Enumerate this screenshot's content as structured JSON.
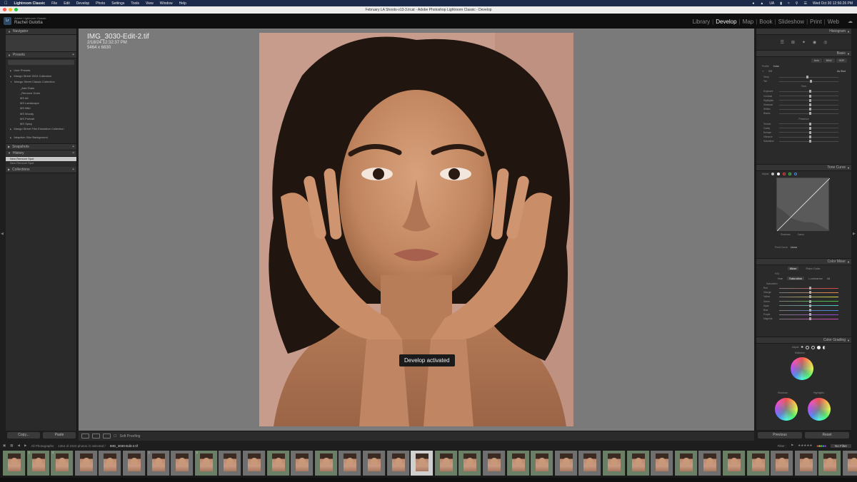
{
  "menubar": {
    "app": "Lightroom Classic",
    "items": [
      "File",
      "Edit",
      "Develop",
      "Photo",
      "Settings",
      "Tools",
      "View",
      "Window",
      "Help"
    ],
    "flag": "UA",
    "datetime": "Wed Oct 30  12:56:26 PM"
  },
  "window": {
    "title": "February LA Shoots-v13-3.lrcat - Adobe Photoshop Lightroom Classic - Develop"
  },
  "identity": {
    "product": "Adobe Lightroom Classic",
    "user": "Rachel Gulotta"
  },
  "modules": {
    "items": [
      "Library",
      "Develop",
      "Map",
      "Book",
      "Slideshow",
      "Print",
      "Web"
    ],
    "active": "Develop"
  },
  "left_panel": {
    "navigator": "Navigator",
    "presets": "Presets",
    "search_placeholder": "",
    "preset_items": [
      {
        "label": "User Presets",
        "level": 1
      },
      {
        "label": "Mango Street 2024 Collection",
        "level": 1
      },
      {
        "label": "Mango Street Classic Collection",
        "level": 1
      },
      {
        "label": "_Add Grain",
        "level": 2
      },
      {
        "label": "_Remove Grain",
        "level": 2
      },
      {
        "label": "MS Alt",
        "level": 2
      },
      {
        "label": "MS Landscape",
        "level": 2
      },
      {
        "label": "MS Mild",
        "level": 2
      },
      {
        "label": "MS Moody",
        "level": 2
      },
      {
        "label": "MS Portrait",
        "level": 2
      },
      {
        "label": "MS Spicy",
        "level": 2
      },
      {
        "label": "Mango Street Film Emulation Collection",
        "level": 1
      },
      {
        "label": "Adaptive: Blur Background",
        "level": 1
      }
    ],
    "snapshots": "Snapshots",
    "history": "History",
    "history_items": [
      "New Remove Spot",
      "New Remove Spot"
    ],
    "collections": "Collections",
    "copy_button": "Copy...",
    "paste_button": "Paste"
  },
  "photo_info": {
    "filename": "IMG_3030-Edit-2.tif",
    "datetime": "2/18/24 12:32:37 PM",
    "dimensions": "5464 x 6830"
  },
  "toast": "Develop activated",
  "toolbar": {
    "soft_proofing": "Soft Proofing"
  },
  "right_panel": {
    "histogram": "Histogram",
    "basic": "Basic",
    "auto_buttons": [
      "Auto",
      "B&W",
      "HDR"
    ],
    "profile_label": "Profile",
    "profile_value": "Color",
    "wb_label": "WB",
    "wb_value": "As Shot",
    "basic_sliders": [
      "Temp",
      "Tint",
      "Exposure",
      "Contrast",
      "Highlights",
      "Shadows",
      "Whites",
      "Blacks",
      "Texture",
      "Clarity",
      "Dehaze",
      "Vibrance",
      "Saturation"
    ],
    "tone_label": "Tone",
    "presence_label": "Presence",
    "tone_curve": "Tone Curve",
    "adjust_label": "Adjust",
    "curve_labels": [
      "Shadows",
      "Darks",
      "Lights",
      "Highlights"
    ],
    "point_curve_label": "Point Curve",
    "point_curve_value": "Linear",
    "color_mixer": "Color Mixer",
    "mixer_tabs": [
      "Mixer",
      "Point Color"
    ],
    "mixer_adjust": "HSL",
    "hsl_tabs": [
      "Hue",
      "Saturation",
      "Luminance",
      "All"
    ],
    "hsl_active": "Saturation",
    "saturation_label": "Saturation",
    "hsl_colors": [
      "Red",
      "Orange",
      "Yellow",
      "Green",
      "Aqua",
      "Blue",
      "Purple",
      "Magenta"
    ],
    "color_grading": "Color Grading",
    "grading_adjust": "Adjust",
    "midtones_label": "Midtones",
    "shadows_label": "Shadows",
    "highlights_label": "Highlights",
    "previous_button": "Previous",
    "reset_button": "Reset"
  },
  "filmbar": {
    "source": "All Photographs",
    "count": "1364 of 2322 photos /1 selected /",
    "selected_file": "IMG_3030-Edit-2.tif",
    "filter_label": "Filter :",
    "filter_value": "No Filter"
  },
  "filmstrip": {
    "cells": [
      {
        "tone": "green"
      },
      {
        "tone": "green",
        "badge": "2"
      },
      {
        "tone": "green",
        "badge": "2"
      },
      {
        "tone": "gray"
      },
      {
        "tone": "gray"
      },
      {
        "tone": "gray"
      },
      {
        "tone": "gray",
        "badge": "2"
      },
      {
        "tone": "gray"
      },
      {
        "tone": "green",
        "badge": "2"
      },
      {
        "tone": "gray"
      },
      {
        "tone": "gray"
      },
      {
        "tone": "green"
      },
      {
        "tone": "gray"
      },
      {
        "tone": "green"
      },
      {
        "tone": "gray"
      },
      {
        "tone": "gray"
      },
      {
        "tone": "gray"
      },
      {
        "tone": "sel",
        "badge": "2"
      },
      {
        "tone": "green"
      },
      {
        "tone": "green"
      },
      {
        "tone": "gray"
      },
      {
        "tone": "green"
      },
      {
        "tone": "green"
      },
      {
        "tone": "gray"
      },
      {
        "tone": "gray"
      },
      {
        "tone": "green"
      },
      {
        "tone": "green"
      },
      {
        "tone": "gray"
      },
      {
        "tone": "green"
      },
      {
        "tone": "gray"
      },
      {
        "tone": "green"
      },
      {
        "tone": "green"
      },
      {
        "tone": "gray"
      },
      {
        "tone": "gray"
      },
      {
        "tone": "green"
      },
      {
        "tone": "gray"
      }
    ]
  }
}
